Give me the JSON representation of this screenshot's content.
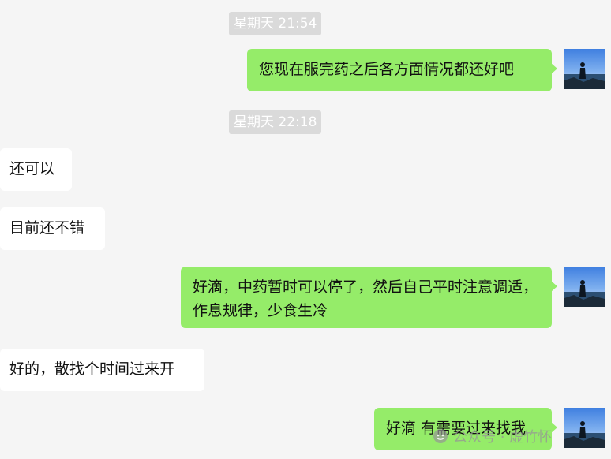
{
  "chat": {
    "timestamps": [
      "星期天 21:54",
      "星期天 22:18"
    ],
    "messages": [
      {
        "side": "right",
        "text": "您现在服完药之后各方面情况都还好吧"
      },
      {
        "side": "left",
        "text": "还可以"
      },
      {
        "side": "left",
        "text": "目前还不错"
      },
      {
        "side": "right",
        "text": "好滴，中药暂时可以停了，然后自己平时注意调适，作息规律，少食生冷"
      },
      {
        "side": "left",
        "text": "好的，散找个时间过来开"
      },
      {
        "side": "right",
        "text": "好滴 有需要过来找我"
      }
    ]
  },
  "watermark": {
    "text": "公众号 · 虚竹怀",
    "icon": "wechat-official-account-icon"
  },
  "colors": {
    "background": "#f5f5f5",
    "self_bubble": "#95ec69",
    "other_bubble": "#ffffff",
    "timestamp_badge": "#dadada"
  }
}
